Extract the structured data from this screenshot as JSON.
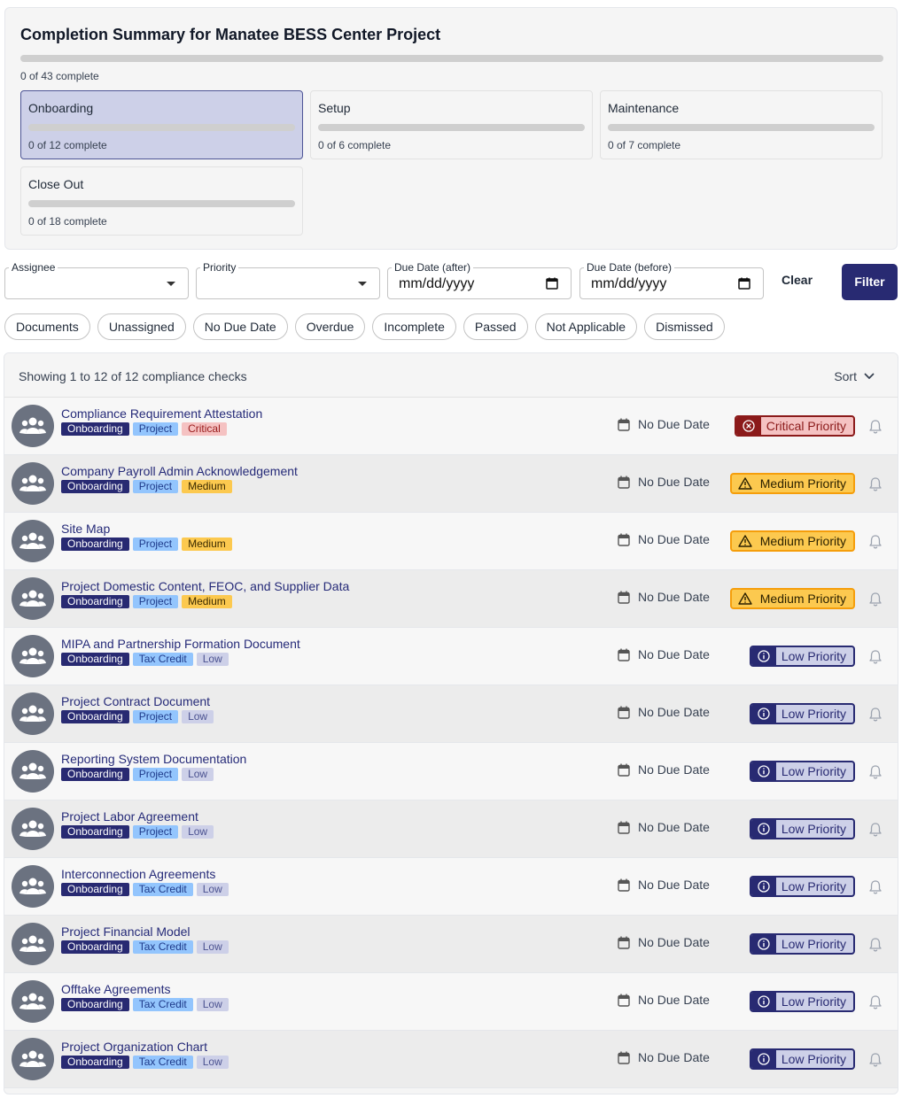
{
  "summary": {
    "title": "Completion Summary for Manatee BESS Center Project",
    "overall_text": "0 of 43 complete",
    "overall_progress": 0,
    "stages": [
      {
        "name": "Onboarding",
        "count": "0 of 12 complete",
        "progress": 0,
        "active": true
      },
      {
        "name": "Setup",
        "count": "0 of 6 complete",
        "progress": 0,
        "active": false
      },
      {
        "name": "Maintenance",
        "count": "0 of 7 complete",
        "progress": 0,
        "active": false
      },
      {
        "name": "Close Out",
        "count": "0 of 18 complete",
        "progress": 0,
        "active": false
      }
    ]
  },
  "filters": {
    "assignee_label": "Assignee",
    "priority_label": "Priority",
    "due_after_label": "Due Date (after)",
    "due_before_label": "Due Date (before)",
    "date_placeholder": "mm/dd/yyyy",
    "clear_label": "Clear",
    "filter_label": "Filter"
  },
  "chips": [
    "Documents",
    "Unassigned",
    "No Due Date",
    "Overdue",
    "Incomplete",
    "Passed",
    "Not Applicable",
    "Dismissed"
  ],
  "list": {
    "showing_text": "Showing 1 to 12 of 12 compliance checks",
    "sort_label": "Sort",
    "due_text": "No Due Date",
    "rows": [
      {
        "title": "Compliance Requirement Attestation",
        "stage": "Onboarding",
        "category": "Project",
        "priority_tag": "Critical",
        "priority_badge": "Critical Priority",
        "level": "critical"
      },
      {
        "title": "Company Payroll Admin Acknowledgement",
        "stage": "Onboarding",
        "category": "Project",
        "priority_tag": "Medium",
        "priority_badge": "Medium Priority",
        "level": "medium"
      },
      {
        "title": "Site Map",
        "stage": "Onboarding",
        "category": "Project",
        "priority_tag": "Medium",
        "priority_badge": "Medium Priority",
        "level": "medium"
      },
      {
        "title": "Project Domestic Content, FEOC, and Supplier Data",
        "stage": "Onboarding",
        "category": "Project",
        "priority_tag": "Medium",
        "priority_badge": "Medium Priority",
        "level": "medium"
      },
      {
        "title": "MIPA and Partnership Formation Document",
        "stage": "Onboarding",
        "category": "Tax Credit",
        "priority_tag": "Low",
        "priority_badge": "Low Priority",
        "level": "low"
      },
      {
        "title": "Project Contract Document",
        "stage": "Onboarding",
        "category": "Project",
        "priority_tag": "Low",
        "priority_badge": "Low Priority",
        "level": "low"
      },
      {
        "title": "Reporting System Documentation",
        "stage": "Onboarding",
        "category": "Project",
        "priority_tag": "Low",
        "priority_badge": "Low Priority",
        "level": "low"
      },
      {
        "title": "Project Labor Agreement",
        "stage": "Onboarding",
        "category": "Project",
        "priority_tag": "Low",
        "priority_badge": "Low Priority",
        "level": "low"
      },
      {
        "title": "Interconnection Agreements",
        "stage": "Onboarding",
        "category": "Tax Credit",
        "priority_tag": "Low",
        "priority_badge": "Low Priority",
        "level": "low"
      },
      {
        "title": "Project Financial Model",
        "stage": "Onboarding",
        "category": "Tax Credit",
        "priority_tag": "Low",
        "priority_badge": "Low Priority",
        "level": "low"
      },
      {
        "title": "Offtake Agreements",
        "stage": "Onboarding",
        "category": "Tax Credit",
        "priority_tag": "Low",
        "priority_badge": "Low Priority",
        "level": "low"
      },
      {
        "title": "Project Organization Chart",
        "stage": "Onboarding",
        "category": "Tax Credit",
        "priority_tag": "Low",
        "priority_badge": "Low Priority",
        "level": "low"
      }
    ]
  },
  "icons": {
    "avatar": "users-group-icon",
    "calendar": "calendar-icon",
    "bell": "bell-icon",
    "sort": "chevron-down-icon",
    "critical": "x-circle-icon",
    "medium": "warning-triangle-icon",
    "low": "info-circle-icon"
  },
  "colors": {
    "brand": "#282a72",
    "critical": "#8b1a1a",
    "medium": "#fcc94f",
    "low": "#cdd0e8"
  }
}
